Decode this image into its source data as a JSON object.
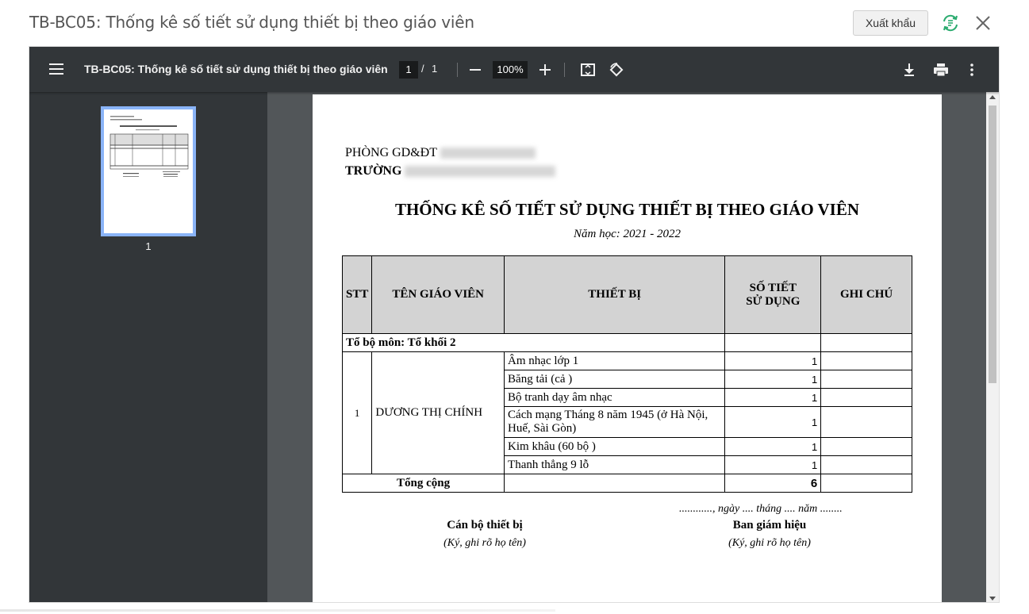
{
  "modal": {
    "title": "TB-BC05: Thống kê số tiết sử dụng thiết bị theo giáo viên",
    "export_label": "Xuất khẩu"
  },
  "toolbar": {
    "doc_title": "TB-BC05: Thống kê số tiết sử dụng thiết bị theo giáo viên",
    "page_current": "1",
    "page_separator": "/",
    "page_total": "1",
    "zoom": "100%"
  },
  "sidebar": {
    "thumbnail_label": "1"
  },
  "report": {
    "dept_label": "PHÒNG GD&ĐT",
    "school_label": "TRƯỜNG",
    "title": "THỐNG KÊ SỐ TIẾT SỬ DỤNG THIẾT BỊ THEO GIÁO VIÊN",
    "year": "Năm học: 2021 - 2022",
    "headers": {
      "stt": "STT",
      "teacher": "TÊN GIÁO VIÊN",
      "device": "THIẾT BỊ",
      "periods_line1": "SỐ TIẾT",
      "periods_line2": "SỬ DỤNG",
      "note": "GHI CHÚ"
    },
    "group_label": "Tổ bộ môn: Tổ khối 2",
    "teacher": {
      "stt": "1",
      "name": "DƯƠNG THỊ CHÍNH"
    },
    "rows": [
      {
        "device": "Âm nhạc lớp 1",
        "periods": "1"
      },
      {
        "device": "Băng tải (cả )",
        "periods": "1"
      },
      {
        "device": "Bộ tranh dạy âm nhạc",
        "periods": "1"
      },
      {
        "device": "Cách mạng Tháng 8 năm 1945 (ở Hà Nội, Huế, Sài Gòn)",
        "periods": "1"
      },
      {
        "device": "Kim khâu (60 bộ )",
        "periods": "1"
      },
      {
        "device": "Thanh thẳng 9 lỗ",
        "periods": "1"
      }
    ],
    "total_label": "Tổng cộng",
    "total_value": "6",
    "signature": {
      "date_line": "............, ngày .... tháng .... năm ........",
      "left_role": "Cán bộ thiết bị",
      "left_note": "(Ký, ghi rõ họ tên)",
      "right_role": "Ban giám hiệu",
      "right_note": "(Ký, ghi rõ họ tên)"
    }
  },
  "colors": {
    "toolbar_bg": "#323639",
    "viewer_bg": "#525659",
    "thumb_border": "#8ab4f8",
    "header_cell_bg": "#d3d3d3",
    "refresh_icon": "#2bab6f"
  }
}
